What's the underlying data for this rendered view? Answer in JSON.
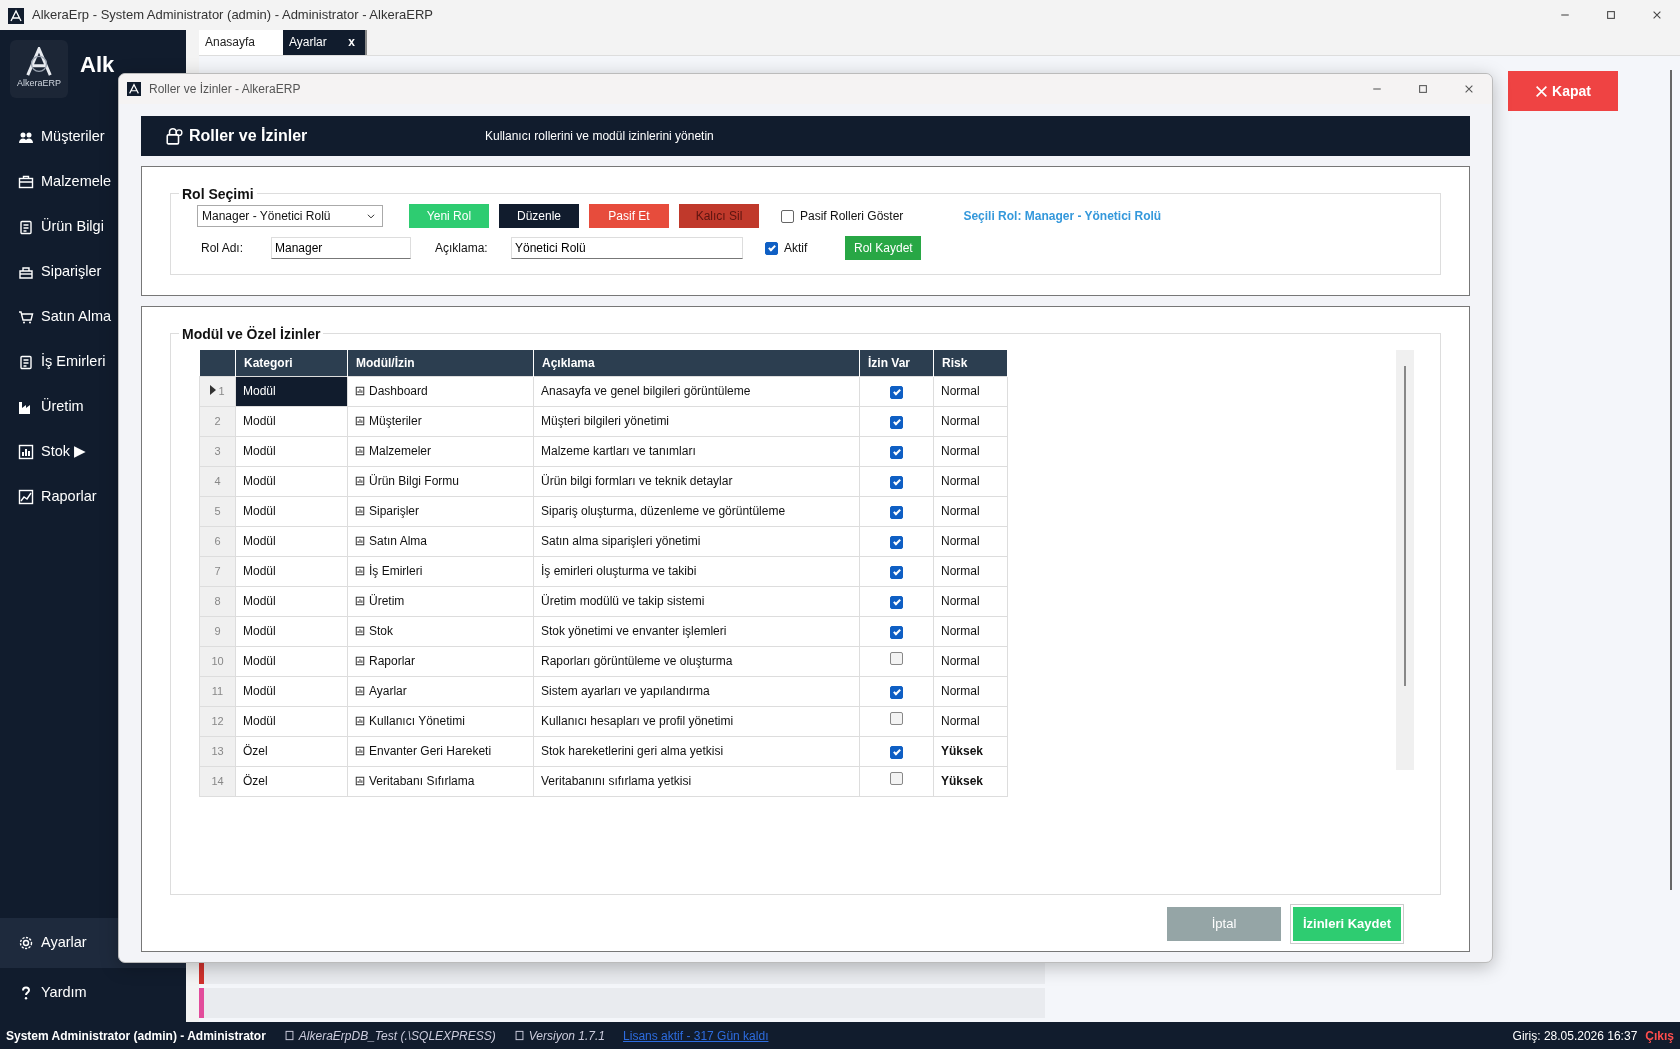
{
  "window": {
    "title": "AlkeraErp - System Administrator (admin) - Administrator - AlkeraERP"
  },
  "sidebar": {
    "logo_text": "AlkeraERP",
    "brand": "Alk",
    "items": [
      {
        "label": "Müşteriler",
        "selected": false
      },
      {
        "label": "Malzemele",
        "selected": false
      },
      {
        "label": "Ürün Bilgi",
        "selected": false
      },
      {
        "label": "Siparişler",
        "selected": false
      },
      {
        "label": "Satın Alma",
        "selected": false
      },
      {
        "label": "İş Emirleri",
        "selected": false
      },
      {
        "label": "Üretim",
        "selected": false
      },
      {
        "label": "Stok ▶",
        "selected": false
      },
      {
        "label": "Raporlar",
        "selected": false
      }
    ],
    "bottom_items": [
      {
        "label": "Ayarlar",
        "selected": true
      },
      {
        "label": "Yardım",
        "selected": false
      }
    ]
  },
  "tabs": [
    {
      "label": "Anasayfa",
      "selected": false
    },
    {
      "label": "Ayarlar",
      "selected": true,
      "close": "x"
    }
  ],
  "close_button": "Kapat",
  "dialog": {
    "title": "Roller ve İzinler - AlkeraERP",
    "header": {
      "title": "Roller ve İzinler",
      "subtitle": "Kullanıcı rollerini ve modül izinlerini yönetin"
    },
    "role_selection": {
      "legend": "Rol Seçimi",
      "role_select": "Manager - Yönetici Rolü",
      "buttons": [
        {
          "label": "Yeni Rol",
          "kind": "new"
        },
        {
          "label": "Düzenle",
          "kind": "edit"
        },
        {
          "label": "Pasif Et",
          "kind": "deactivate"
        },
        {
          "label": "Kalıcı Sil",
          "kind": "delete"
        }
      ],
      "show_passive": {
        "label": "Pasif Rolleri Göster",
        "checked": false
      },
      "selected_role": "Seçili Rol: Manager - Yönetici Rolü",
      "name_label": "Rol Adı:",
      "name_value": "Manager",
      "desc_label": "Açıklama:",
      "desc_value": "Yönetici Rolü",
      "active": {
        "label": "Aktif",
        "checked": true
      },
      "save_button": "Rol Kaydet"
    },
    "permissions": {
      "legend": "Modül ve Özel İzinler",
      "columns": [
        "Kategori",
        "Modül/İzin",
        "Açıklama",
        "İzin Var",
        "Risk"
      ],
      "rows": [
        {
          "number": "1",
          "category": "Modül",
          "permission": "Dashboard",
          "description": "Anasayfa ve genel bilgileri görüntüleme",
          "allowed": true,
          "risk": "Normal",
          "risk_high": false,
          "selected": true
        },
        {
          "number": "2",
          "category": "Modül",
          "permission": "Müşteriler",
          "description": "Müşteri bilgileri yönetimi",
          "allowed": true,
          "risk": "Normal",
          "risk_high": false,
          "selected": false
        },
        {
          "number": "3",
          "category": "Modül",
          "permission": "Malzemeler",
          "description": "Malzeme kartları ve tanımları",
          "allowed": true,
          "risk": "Normal",
          "risk_high": false,
          "selected": false
        },
        {
          "number": "4",
          "category": "Modül",
          "permission": "Ürün Bilgi Formu",
          "description": "Ürün bilgi formları ve teknik detaylar",
          "allowed": true,
          "risk": "Normal",
          "risk_high": false,
          "selected": false
        },
        {
          "number": "5",
          "category": "Modül",
          "permission": "Siparişler",
          "description": "Sipariş oluşturma, düzenleme ve görüntüleme",
          "allowed": true,
          "risk": "Normal",
          "risk_high": false,
          "selected": false
        },
        {
          "number": "6",
          "category": "Modül",
          "permission": "Satın Alma",
          "description": "Satın alma siparişleri yönetimi",
          "allowed": true,
          "risk": "Normal",
          "risk_high": false,
          "selected": false
        },
        {
          "number": "7",
          "category": "Modül",
          "permission": "İş Emirleri",
          "description": "İş emirleri oluşturma ve takibi",
          "allowed": true,
          "risk": "Normal",
          "risk_high": false,
          "selected": false
        },
        {
          "number": "8",
          "category": "Modül",
          "permission": "Üretim",
          "description": "Üretim modülü ve takip sistemi",
          "allowed": true,
          "risk": "Normal",
          "risk_high": false,
          "selected": false
        },
        {
          "number": "9",
          "category": "Modül",
          "permission": "Stok",
          "description": "Stok yönetimi ve envanter işlemleri",
          "allowed": true,
          "risk": "Normal",
          "risk_high": false,
          "selected": false
        },
        {
          "number": "10",
          "category": "Modül",
          "permission": "Raporlar",
          "description": "Raporları görüntüleme ve oluşturma",
          "allowed": false,
          "risk": "Normal",
          "risk_high": false,
          "selected": false
        },
        {
          "number": "11",
          "category": "Modül",
          "permission": "Ayarlar",
          "description": "Sistem ayarları ve yapılandırma",
          "allowed": true,
          "risk": "Normal",
          "risk_high": false,
          "selected": false
        },
        {
          "number": "12",
          "category": "Modül",
          "permission": "Kullanıcı Yönetimi",
          "description": "Kullanıcı hesapları ve profil yönetimi",
          "allowed": false,
          "risk": "Normal",
          "risk_high": false,
          "selected": false
        },
        {
          "number": "13",
          "category": "Özel",
          "permission": "Envanter Geri Hareketi",
          "description": "Stok hareketlerini geri alma yetkisi",
          "allowed": true,
          "risk": "Yüksek",
          "risk_high": true,
          "selected": false
        },
        {
          "number": "14",
          "category": "Özel",
          "permission": "Veritabanı Sıfırlama",
          "description": "Veritabanını sıfırlama yetkisi",
          "allowed": false,
          "risk": "Yüksek",
          "risk_high": true,
          "selected": false
        }
      ]
    },
    "footer_buttons": [
      {
        "label": "İptal",
        "kind": "cancel"
      },
      {
        "label": "İzinleri Kaydet",
        "kind": "save"
      }
    ]
  },
  "status_bar": {
    "user": "System Administrator (admin) - Administrator",
    "database": "AlkeraErpDB_Test (.\\SQLEXPRESS)",
    "version": "Versiyon 1.7.1",
    "license": "Lisans aktif - 317 Gün kaldı",
    "login": "Giriş: 28.05.2026 16:37",
    "logout": "Çıkış"
  }
}
